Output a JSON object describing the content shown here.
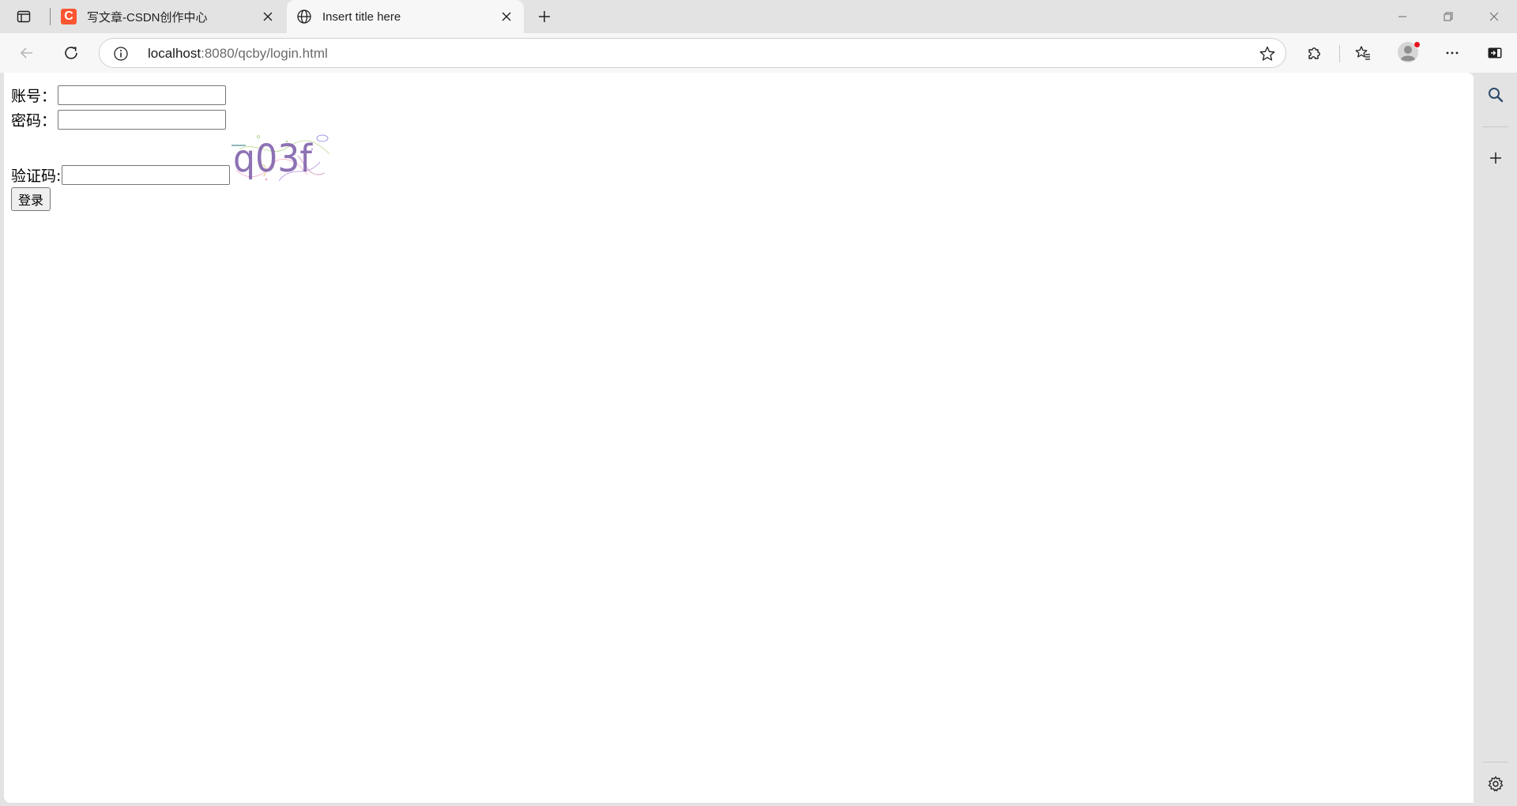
{
  "browser": {
    "tabs": [
      {
        "title": "写文章-CSDN创作中心",
        "favicon_letter": "C",
        "active": false
      },
      {
        "title": "Insert title here",
        "active": true
      }
    ],
    "address_bar": {
      "host": "localhost",
      "rest": ":8080/qcby/login.html"
    }
  },
  "form": {
    "account_label": "账号：",
    "account_value": "",
    "password_label": "密码：",
    "password_value": "",
    "captcha_label": "验证码:",
    "captcha_value": "",
    "captcha_text": "q03f",
    "login_label": "登录"
  },
  "colors": {
    "csdn_brand": "#fc5531",
    "notification_dot": "#e5121f"
  },
  "icons": {
    "tab_actions": "tab-actions-icon",
    "new_tab": "plus-icon",
    "back": "back-arrow-icon",
    "refresh": "refresh-icon",
    "site_info": "info-icon",
    "favorite": "star-icon",
    "extensions": "puzzle-icon",
    "favorites": "favorites-icon",
    "profile": "avatar-icon",
    "more": "more-icon",
    "sidebar_toggle": "sidebar-toggle-icon",
    "sidebar_search": "search-icon",
    "sidebar_add": "plus-icon",
    "sidebar_settings": "gear-icon"
  }
}
